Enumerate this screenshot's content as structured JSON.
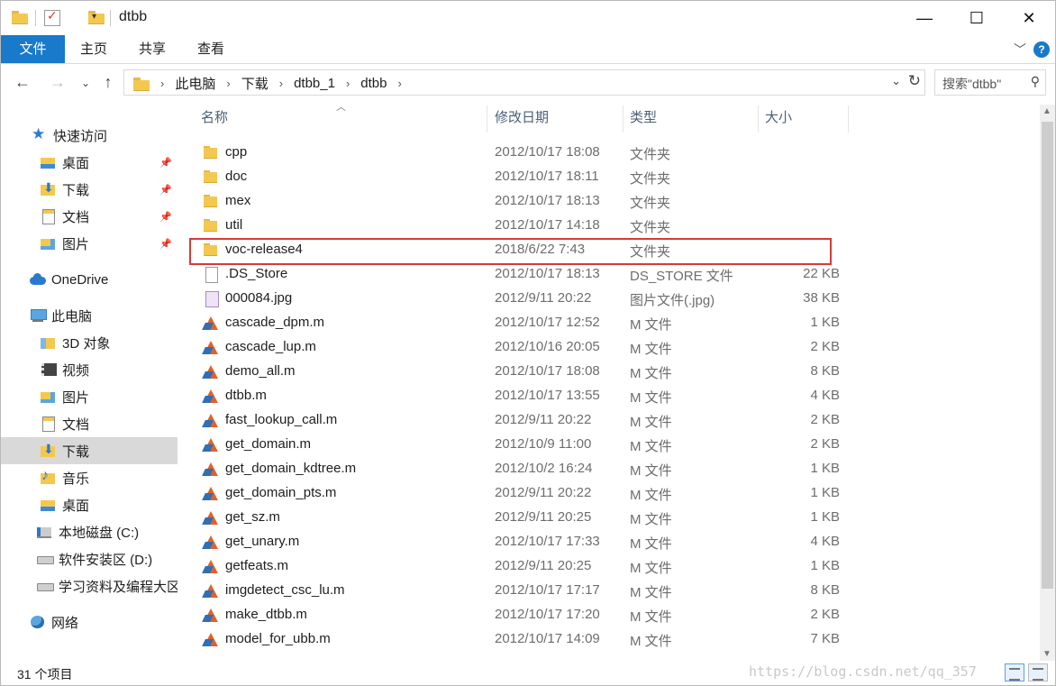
{
  "window": {
    "title": "dtbb",
    "buttons": {
      "minimize": "—",
      "maximize": "☐",
      "close": "✕"
    }
  },
  "ribbon": {
    "tabs": [
      "文件",
      "主页",
      "共享",
      "查看"
    ],
    "expand_icon": "chevron-down-icon",
    "help_label": "?"
  },
  "address": {
    "crumbs": [
      "此电脑",
      "下载",
      "dtbb_1",
      "dtbb"
    ],
    "search_placeholder": "搜索\"dtbb\""
  },
  "nav": {
    "items": [
      {
        "label": "快速访问",
        "icon": "star-icon",
        "pinned": false
      },
      {
        "label": "桌面",
        "icon": "desktop-folder-icon",
        "pinned": true
      },
      {
        "label": "下载",
        "icon": "downloads-folder-icon",
        "pinned": true
      },
      {
        "label": "文档",
        "icon": "documents-folder-icon",
        "pinned": true
      },
      {
        "label": "图片",
        "icon": "pictures-folder-icon",
        "pinned": true
      },
      {
        "label": "OneDrive",
        "icon": "cloud-icon",
        "pinned": false
      },
      {
        "label": "此电脑",
        "icon": "computer-icon",
        "pinned": false
      },
      {
        "label": "3D 对象",
        "icon": "3d-objects-folder-icon",
        "pinned": false
      },
      {
        "label": "视频",
        "icon": "video-folder-icon",
        "pinned": false
      },
      {
        "label": "图片",
        "icon": "pictures-folder-icon",
        "pinned": false
      },
      {
        "label": "文档",
        "icon": "documents-folder-icon",
        "pinned": false
      },
      {
        "label": "下载",
        "icon": "downloads-folder-icon",
        "pinned": false,
        "selected": true
      },
      {
        "label": "音乐",
        "icon": "music-folder-icon",
        "pinned": false
      },
      {
        "label": "桌面",
        "icon": "desktop-folder-icon",
        "pinned": false
      },
      {
        "label": "本地磁盘 (C:)",
        "icon": "windows-drive-icon",
        "pinned": false
      },
      {
        "label": "软件安装区 (D:)",
        "icon": "drive-icon",
        "pinned": false
      },
      {
        "label": "学习资料及编程大区",
        "icon": "drive-icon",
        "pinned": false
      },
      {
        "label": "网络",
        "icon": "network-icon",
        "pinned": false
      }
    ]
  },
  "files": {
    "columns": {
      "name": "名称",
      "date": "修改日期",
      "type": "类型",
      "size": "大小"
    },
    "rows": [
      {
        "name": "cpp",
        "date": "2012/10/17 18:08",
        "type": "文件夹",
        "size": "",
        "icon": "folder-icon"
      },
      {
        "name": "doc",
        "date": "2012/10/17 18:11",
        "type": "文件夹",
        "size": "",
        "icon": "folder-icon"
      },
      {
        "name": "mex",
        "date": "2012/10/17 18:13",
        "type": "文件夹",
        "size": "",
        "icon": "folder-icon"
      },
      {
        "name": "util",
        "date": "2012/10/17 14:18",
        "type": "文件夹",
        "size": "",
        "icon": "folder-icon"
      },
      {
        "name": "voc-release4",
        "date": "2018/6/22 7:43",
        "type": "文件夹",
        "size": "",
        "icon": "folder-icon",
        "highlighted": true
      },
      {
        "name": ".DS_Store",
        "date": "2012/10/17 18:13",
        "type": "DS_STORE 文件",
        "size": "22 KB",
        "icon": "file-icon"
      },
      {
        "name": "000084.jpg",
        "date": "2012/9/11 20:22",
        "type": "图片文件(.jpg)",
        "size": "38 KB",
        "icon": "image-file-icon"
      },
      {
        "name": "cascade_dpm.m",
        "date": "2012/10/17 12:52",
        "type": "M 文件",
        "size": "1 KB",
        "icon": "matlab-icon"
      },
      {
        "name": "cascade_lup.m",
        "date": "2012/10/16 20:05",
        "type": "M 文件",
        "size": "2 KB",
        "icon": "matlab-icon"
      },
      {
        "name": "demo_all.m",
        "date": "2012/10/17 18:08",
        "type": "M 文件",
        "size": "8 KB",
        "icon": "matlab-icon"
      },
      {
        "name": "dtbb.m",
        "date": "2012/10/17 13:55",
        "type": "M 文件",
        "size": "4 KB",
        "icon": "matlab-icon"
      },
      {
        "name": "fast_lookup_call.m",
        "date": "2012/9/11 20:22",
        "type": "M 文件",
        "size": "2 KB",
        "icon": "matlab-icon"
      },
      {
        "name": "get_domain.m",
        "date": "2012/10/9 11:00",
        "type": "M 文件",
        "size": "2 KB",
        "icon": "matlab-icon"
      },
      {
        "name": "get_domain_kdtree.m",
        "date": "2012/10/2 16:24",
        "type": "M 文件",
        "size": "1 KB",
        "icon": "matlab-icon"
      },
      {
        "name": "get_domain_pts.m",
        "date": "2012/9/11 20:22",
        "type": "M 文件",
        "size": "1 KB",
        "icon": "matlab-icon"
      },
      {
        "name": "get_sz.m",
        "date": "2012/9/11 20:25",
        "type": "M 文件",
        "size": "1 KB",
        "icon": "matlab-icon"
      },
      {
        "name": "get_unary.m",
        "date": "2012/10/17 17:33",
        "type": "M 文件",
        "size": "4 KB",
        "icon": "matlab-icon"
      },
      {
        "name": "getfeats.m",
        "date": "2012/9/11 20:25",
        "type": "M 文件",
        "size": "1 KB",
        "icon": "matlab-icon"
      },
      {
        "name": "imgdetect_csc_lu.m",
        "date": "2012/10/17 17:17",
        "type": "M 文件",
        "size": "8 KB",
        "icon": "matlab-icon"
      },
      {
        "name": "make_dtbb.m",
        "date": "2012/10/17 17:20",
        "type": "M 文件",
        "size": "2 KB",
        "icon": "matlab-icon"
      },
      {
        "name": "model_for_ubb.m",
        "date": "2012/10/17 14:09",
        "type": "M 文件",
        "size": "7 KB",
        "icon": "matlab-icon"
      }
    ]
  },
  "status": {
    "item_count": "31 个项目",
    "watermark": "https://blog.csdn.net/qq_357"
  }
}
